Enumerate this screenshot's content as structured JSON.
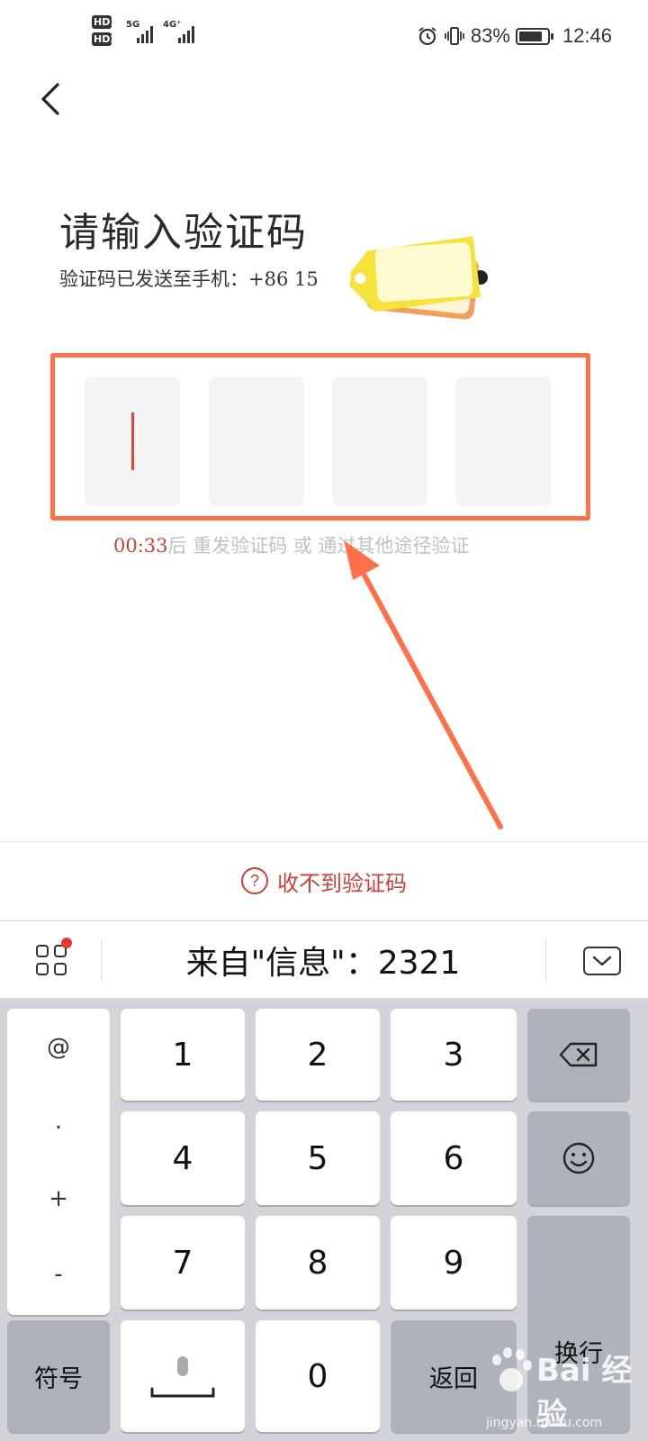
{
  "status_bar": {
    "hd1": "HD1",
    "hd2": "HD2",
    "net1": "5G",
    "net2": "4G⁺",
    "battery_percent": "83%",
    "battery_level": 0.83,
    "time": "12:46"
  },
  "page": {
    "title": "请输入验证码",
    "subtitle": "验证码已发送至手机：+86  15"
  },
  "code_input": {
    "digits": [
      "",
      "",
      "",
      ""
    ],
    "outline_color": "#ff7148"
  },
  "hint": {
    "timer": "00:33",
    "text": "后  重发验证码  或  通过其他途径验证"
  },
  "help": {
    "icon": "?",
    "label": "收不到验证码"
  },
  "suggestion": {
    "text": "来自\"信息\"：2321"
  },
  "keyboard": {
    "symbols": [
      "@",
      ".",
      "+",
      "-"
    ],
    "keys": [
      "1",
      "2",
      "3",
      "4",
      "5",
      "6",
      "7",
      "8",
      "9",
      "0"
    ],
    "symbol_key": "符号",
    "back_key": "返回",
    "enter_key": "换行"
  },
  "watermark": {
    "brand": "Bai 经验",
    "url": "jingyan.baidu.com"
  }
}
